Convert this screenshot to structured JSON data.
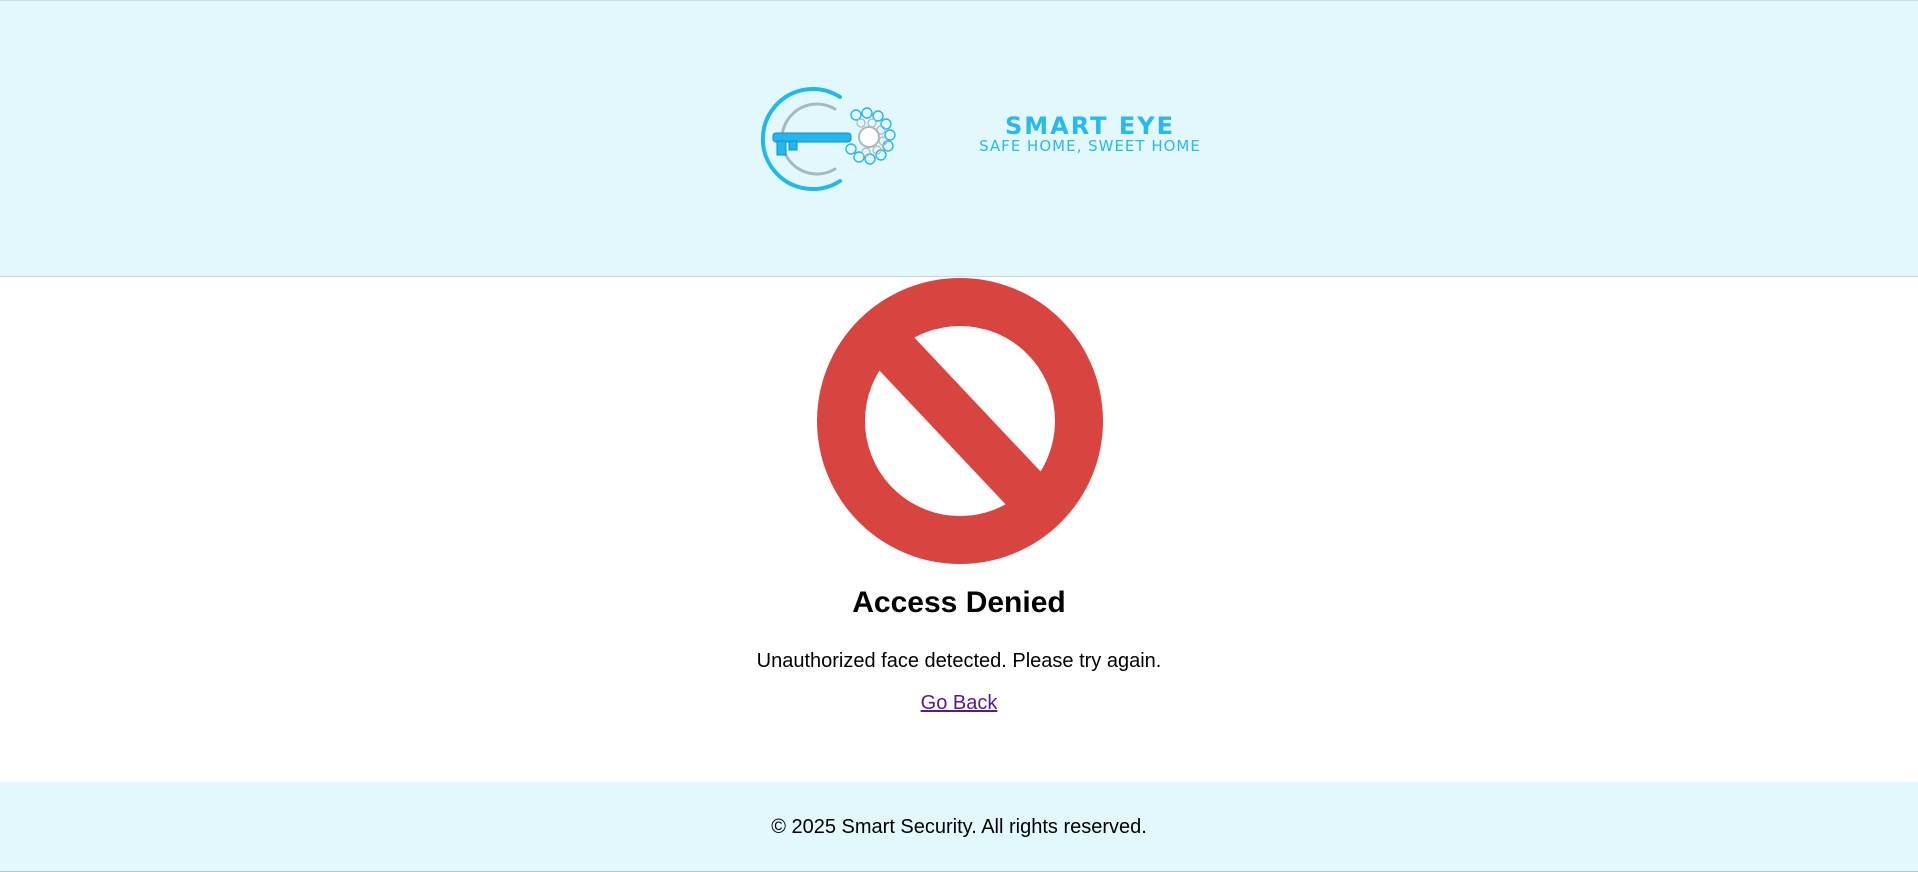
{
  "header": {
    "brand_name": "SMART EYE",
    "brand_tagline": "SAFE HOME, SWEET HOME",
    "logo_icon": "key-eye-logo-icon",
    "brand_color": "#27b9ef",
    "background_color": "#e3f8fd"
  },
  "main": {
    "status_icon": "prohibited-icon",
    "status_icon_color": "#d84540",
    "title": "Access Denied",
    "message": "Unauthorized face detected. Please try again.",
    "back_link_label": "Go Back"
  },
  "footer": {
    "copyright": "© 2025 Smart Security. All rights reserved."
  }
}
